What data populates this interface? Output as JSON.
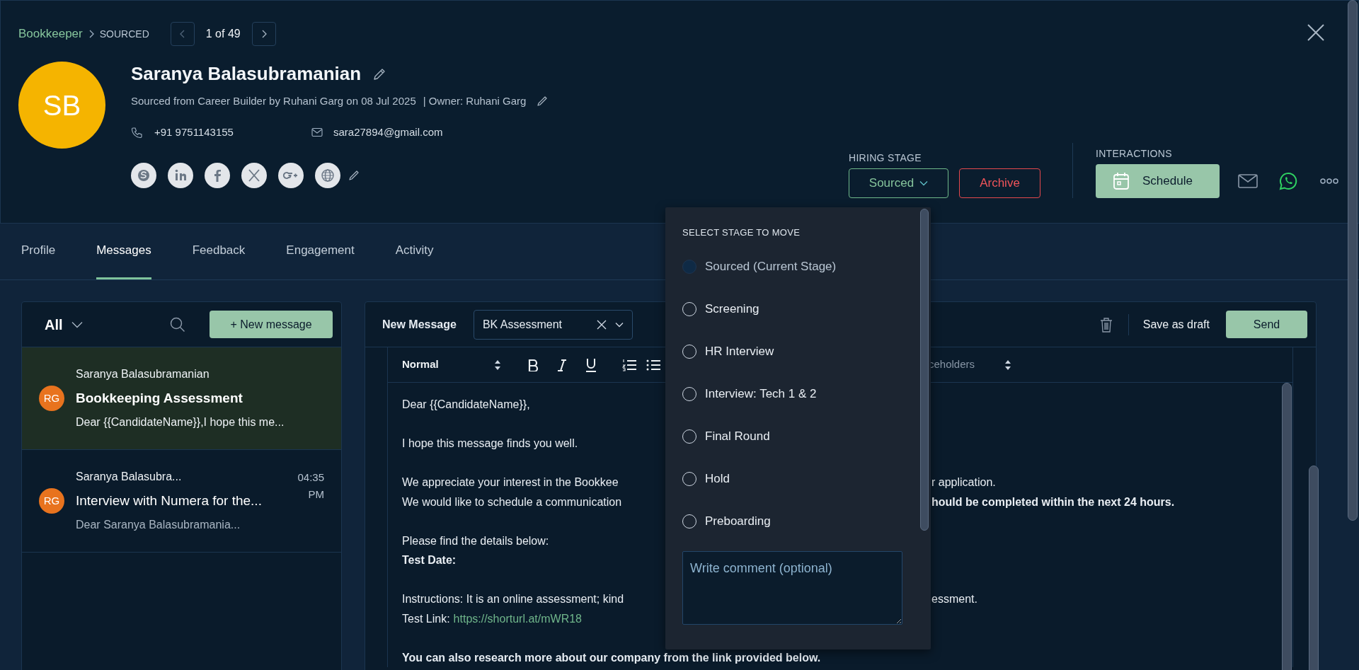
{
  "breadcrumb": {
    "job": "Bookkeeper",
    "stage": "SOURCED"
  },
  "pager": {
    "position": "1 of 49"
  },
  "candidate": {
    "initials": "SB",
    "name": "Saranya Balasubramanian",
    "source": "Sourced from Career Builder by Ruhani Garg on 08 Jul 2025",
    "owner": "| Owner: Ruhani Garg",
    "phone": "+91 9751143155",
    "email": "sara27894@gmail.com"
  },
  "hiring_stage": {
    "label": "HIRING STAGE",
    "value": "Sourced"
  },
  "archive_button": "Archive",
  "interactions": {
    "label": "INTERACTIONS",
    "schedule_button": "Schedule"
  },
  "tabs": [
    {
      "label": "Profile",
      "selected": false
    },
    {
      "label": "Messages",
      "selected": true
    },
    {
      "label": "Feedback",
      "selected": false
    },
    {
      "label": "Engagement",
      "selected": false
    },
    {
      "label": "Activity",
      "selected": false
    }
  ],
  "message_list": {
    "filter": "All",
    "new_button": "+ New message",
    "items": [
      {
        "avatar": "RG",
        "sender": "Saranya Balasubramanian",
        "subject": "Bookkeeping Assessment",
        "preview": "Dear {{CandidateName}},I hope this me...",
        "selected": true
      },
      {
        "avatar": "RG",
        "sender": "Saranya Balasubra...",
        "subject": "Interview with Numera for the...",
        "preview": "Dear Saranya Balasubramania...",
        "time": "04:35 PM",
        "selected": false
      }
    ]
  },
  "composer": {
    "title": "New Message",
    "template": "BK Assessment",
    "draft_button": "Save as draft",
    "send_button": "Send",
    "format": "Normal",
    "placeholders_fragment": "ceholders",
    "paragraphs": [
      [
        {
          "left": {
            "text": "Dear {{CandidateName}},",
            "bold": false
          }
        }
      ],
      [
        {
          "left": {
            "text": "I hope this message finds you well.",
            "bold": false
          }
        }
      ],
      [
        {
          "left": {
            "text": "We appreciate your interest in the Bookkee",
            "bold": false
          },
          "right": {
            "text": "r application.",
            "bold": false
          }
        },
        {
          "left": {
            "text": "We would like to schedule a communication",
            "bold": false
          },
          "right": {
            "text": "hould be completed within the next 24 hours.",
            "bold": true
          }
        }
      ],
      [
        {
          "left": {
            "text": "Please find the details below:",
            "bold": false
          }
        },
        {
          "left": {
            "text": "Test Date:",
            "bold": true
          }
        }
      ],
      [
        {
          "left": {
            "text": "Instructions: It is an online assessment; kind",
            "bold": false
          },
          "right": {
            "text": "essment.",
            "bold": false
          }
        },
        {
          "left": {
            "text": "Test Link:",
            "bold": false
          },
          "link": "https://shorturl.at/mWR18"
        }
      ],
      [
        {
          "full": {
            "text": "You can also research more about our company from the link provided below.",
            "bold": true
          }
        }
      ]
    ]
  },
  "stage_menu": {
    "title": "SELECT STAGE TO MOVE",
    "options": [
      {
        "label": "Sourced (Current Stage)",
        "current": true
      },
      {
        "label": "Screening",
        "current": false
      },
      {
        "label": "HR Interview",
        "current": false
      },
      {
        "label": "Interview: Tech 1 & 2",
        "current": false
      },
      {
        "label": "Final Round",
        "current": false
      },
      {
        "label": "Hold",
        "current": false
      },
      {
        "label": "Preboarding",
        "current": false
      }
    ],
    "comment_placeholder": "Write comment (optional)"
  }
}
